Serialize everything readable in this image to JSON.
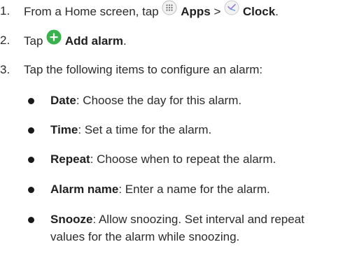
{
  "steps": [
    {
      "number": "1.",
      "prefix": "From a Home screen, tap",
      "apps_label": "Apps",
      "separator": ">",
      "clock_label": "Clock",
      "suffix": "."
    },
    {
      "number": "2.",
      "prefix": "Tap",
      "add_alarm_label": "Add alarm",
      "suffix": "."
    },
    {
      "number": "3.",
      "text": "Tap the following items to configure an alarm:"
    }
  ],
  "bullets": [
    {
      "term": "Date",
      "desc": ": Choose the day for this alarm."
    },
    {
      "term": "Time",
      "desc": ": Set a time for the alarm."
    },
    {
      "term": "Repeat",
      "desc": ": Choose when to repeat the alarm."
    },
    {
      "term": "Alarm name",
      "desc": ": Enter a name for the alarm."
    },
    {
      "term": "Snooze",
      "desc": ": Allow snoozing. Set interval and repeat",
      "desc_line2": "values for the alarm while snoozing."
    }
  ],
  "colors": {
    "add_icon": "#37b24d",
    "text": "#2b2b2b"
  },
  "icons": {
    "apps": "apps-grid-icon",
    "clock": "clock-app-icon",
    "add": "add-plus-icon"
  }
}
